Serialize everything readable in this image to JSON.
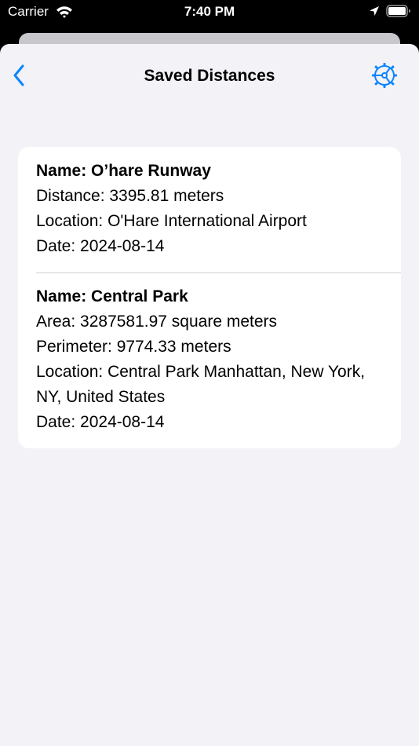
{
  "status_bar": {
    "carrier": "Carrier",
    "time": "7:40 PM",
    "icons": [
      "wifi-icon",
      "location-arrow-icon",
      "battery-icon"
    ]
  },
  "nav": {
    "title": "Saved Distances",
    "back_icon": "chevron-left-icon",
    "settings_icon": "steering-wheel-gear-icon",
    "accent_color": "#0a84ff"
  },
  "saved_items": [
    {
      "lines": [
        "Name: O’hare Runway",
        "Distance: 3395.81 meters",
        "Location: O'Hare International Airport",
        "Date: 2024-08-14"
      ]
    },
    {
      "lines": [
        "Name: Central Park",
        "Area: 3287581.97 square meters",
        "Perimeter: 9774.33 meters",
        "Location: Central Park Manhattan, New York, NY, United States",
        "Date: 2024-08-14"
      ]
    }
  ],
  "colors": {
    "background": "#f2f2f7",
    "card": "#ffffff",
    "separator": "#d1d1d6",
    "status_bar": "#000000"
  }
}
